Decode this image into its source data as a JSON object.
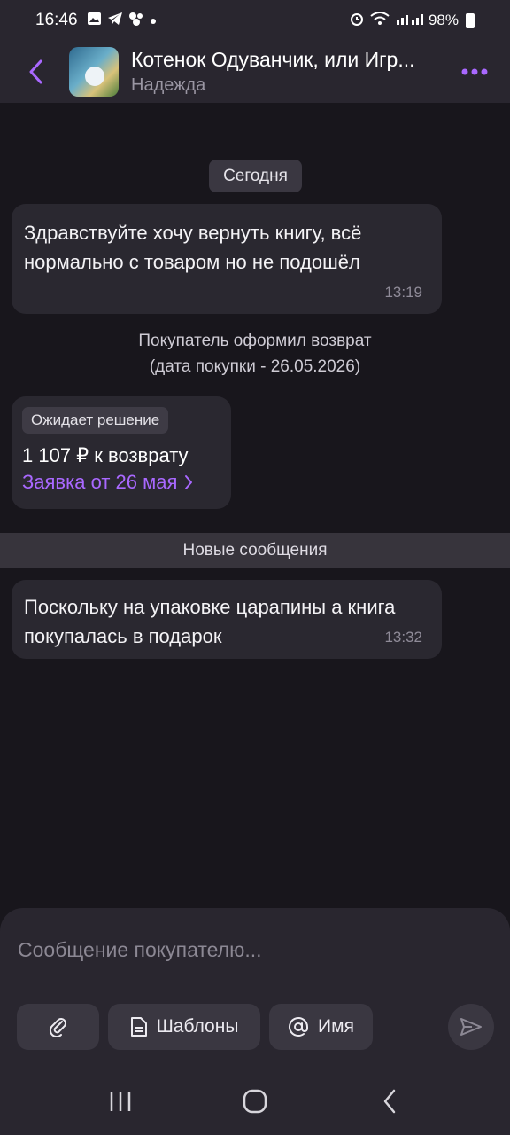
{
  "status": {
    "time": "16:46",
    "battery": "98%",
    "notif_icons": [
      "gallery-icon",
      "telegram-icon",
      "cluster-icon",
      "dot-icon"
    ]
  },
  "header": {
    "title": "Котенок Одуванчик, или Игр...",
    "subtitle": "Надежда"
  },
  "chat": {
    "date_label": "Сегодня",
    "messages": [
      {
        "text": "Здравствуйте хочу вернуть книгу, всё нормально с товаром но не подошёл",
        "time": "13:19"
      },
      {
        "text": "Поскольку на упаковке царапины а книга покупалась в подарок",
        "time": "13:32"
      }
    ],
    "system_line1": "Покупатель оформил возврат",
    "system_line2": "(дата покупки - 26.05.2026)",
    "refund": {
      "badge": "Ожидает решение",
      "amount": "1 107 ₽ к возврату",
      "link": "Заявка от 26 мая"
    },
    "new_messages_label": "Новые сообщения"
  },
  "composer": {
    "placeholder": "Сообщение покупателю...",
    "templates_label": "Шаблоны",
    "name_label": "Имя"
  },
  "colors": {
    "accent": "#a968ff",
    "background": "#18161c",
    "bubble": "#2a2830"
  }
}
